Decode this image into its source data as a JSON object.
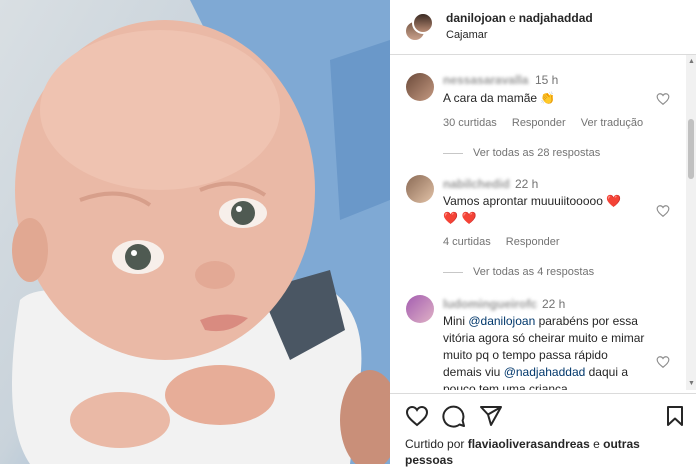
{
  "header": {
    "user1": "danilojoan",
    "conjunction": "e",
    "user2": "nadjahaddad",
    "location": "Cajamar"
  },
  "comments": [
    {
      "username": "nessasaravalla",
      "time": "15 h",
      "text": "A cara da mamãe",
      "emoji": "👏",
      "likes": "30 curtidas",
      "reply": "Responder",
      "translate": "Ver tradução",
      "view_replies": "Ver todas as 28 respostas"
    },
    {
      "username": "nabilchedid",
      "time": "22 h",
      "text": "Vamos aprontar muuuiitooooo",
      "emoji": "❤️",
      "emoji_line": "❤️ ❤️",
      "likes": "4 curtidas",
      "reply": "Responder",
      "view_replies": "Ver todas as 4 respostas"
    },
    {
      "username": "ludomingueirofc",
      "time": "22 h",
      "text_before": "Mini ",
      "mention1": "@danilojoan",
      "text_middle": " parabéns por essa vitória agora só cheirar muito e mimar muito pq o tempo passa rápido demais viu ",
      "mention2": "@nadjahaddad",
      "text_after": " daqui a pouco tem uma criança"
    }
  ],
  "footer": {
    "liked_by_prefix": "Curtido por ",
    "liked_by_user": "flaviaoliverasandreas",
    "liked_by_suffix": " e ",
    "liked_by_others": "outras pessoas"
  },
  "colors": {
    "text": "#262626",
    "secondary": "#737373",
    "mention": "#00376b",
    "heart_red": "#ed1c24"
  },
  "icons": [
    "heart-icon",
    "comment-icon",
    "share-icon",
    "bookmark-icon"
  ]
}
